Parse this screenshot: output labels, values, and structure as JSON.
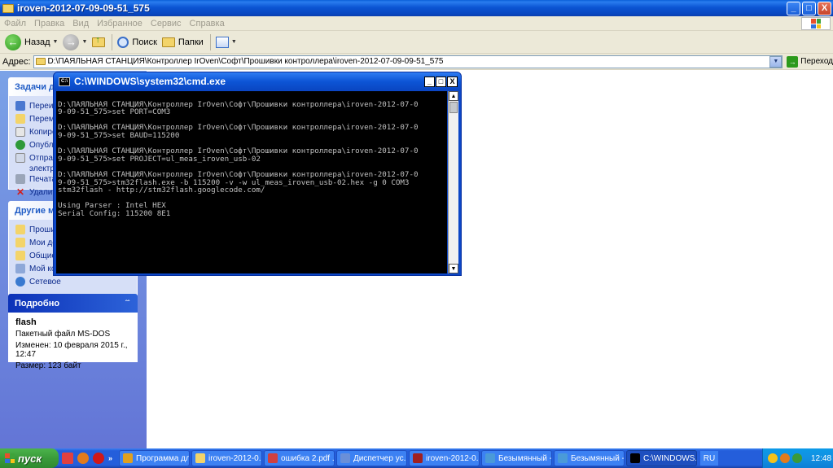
{
  "window": {
    "title": "iroven-2012-07-09-09-51_575",
    "min": "_",
    "max": "□",
    "close": "X"
  },
  "menu": [
    "Файл",
    "Правка",
    "Вид",
    "Избранное",
    "Сервис",
    "Справка"
  ],
  "toolbar": {
    "back": "Назад",
    "search": "Поиск",
    "folders": "Папки"
  },
  "address": {
    "label": "Адрес:",
    "value": "D:\\ПАЯЛЬНАЯ СТАНЦИЯ\\Контроллер IrOven\\Софт\\Прошивки контроллера\\iroven-2012-07-09-09-51_575",
    "go": "Переход"
  },
  "tasks": {
    "title": "Задачи для",
    "items": [
      "Переим",
      "Перемес",
      "Копиров",
      "Опублик",
      "Отправ",
      "электр",
      "Печата",
      "Удалить"
    ]
  },
  "other": {
    "title": "Другие мес",
    "items": [
      "Прошив",
      "Мои док",
      "Общие ,",
      "Мой ком",
      "Сетевое"
    ]
  },
  "details": {
    "title": "Подробно",
    "name": "flash",
    "type": "Пакетный файл MS-DOS",
    "modified": "Изменен: 10 февраля 2015 г., 12:47",
    "size": "Размер: 123 байт"
  },
  "cmd": {
    "title": "C:\\WINDOWS\\system32\\cmd.exe",
    "min": "_",
    "max": "□",
    "close": "X",
    "lines": [
      "",
      "D:\\ПАЯЛЬНАЯ СТАНЦИЯ\\Контроллер IrOven\\Софт\\Прошивки контроллера\\iroven-2012-07-0",
      "9-09-51_575>set PORT=COM3",
      "",
      "D:\\ПАЯЛЬНАЯ СТАНЦИЯ\\Контроллер IrOven\\Софт\\Прошивки контроллера\\iroven-2012-07-0",
      "9-09-51_575>set BAUD=115200",
      "",
      "D:\\ПАЯЛЬНАЯ СТАНЦИЯ\\Контроллер IrOven\\Софт\\Прошивки контроллера\\iroven-2012-07-0",
      "9-09-51_575>set PROJECT=ul_meas_iroven_usb-02",
      "",
      "D:\\ПАЯЛЬНАЯ СТАНЦИЯ\\Контроллер IrOven\\Софт\\Прошивки контроллера\\iroven-2012-07-0",
      "9-09-51_575>stm32flash.exe -b 115200 -v -w ul_meas_iroven_usb-02.hex -g 0 COM3",
      "stm32flash - http://stm32flash.googlecode.com/",
      "",
      "Using Parser : Intel HEX",
      "Serial Config: 115200 8E1"
    ]
  },
  "taskbar": {
    "start": "пуск",
    "more": "»",
    "tasks": [
      {
        "label": "Программа дл...",
        "color": "#e0a020"
      },
      {
        "label": "iroven-2012-0...",
        "color": "#f3d46a"
      },
      {
        "label": "ошибка 2.pdf ...",
        "color": "#d04040"
      },
      {
        "label": "Диспетчер ус...",
        "color": "#6a8fd8"
      },
      {
        "label": "iroven-2012-0...",
        "color": "#a02020"
      },
      {
        "label": "Безымянный -...",
        "color": "#4a9ad8"
      },
      {
        "label": "Безымянный -...",
        "color": "#4a9ad8"
      },
      {
        "label": "C:\\WINDOWS...",
        "color": "#000000"
      }
    ],
    "lang": "RU",
    "clock": "12:48"
  }
}
